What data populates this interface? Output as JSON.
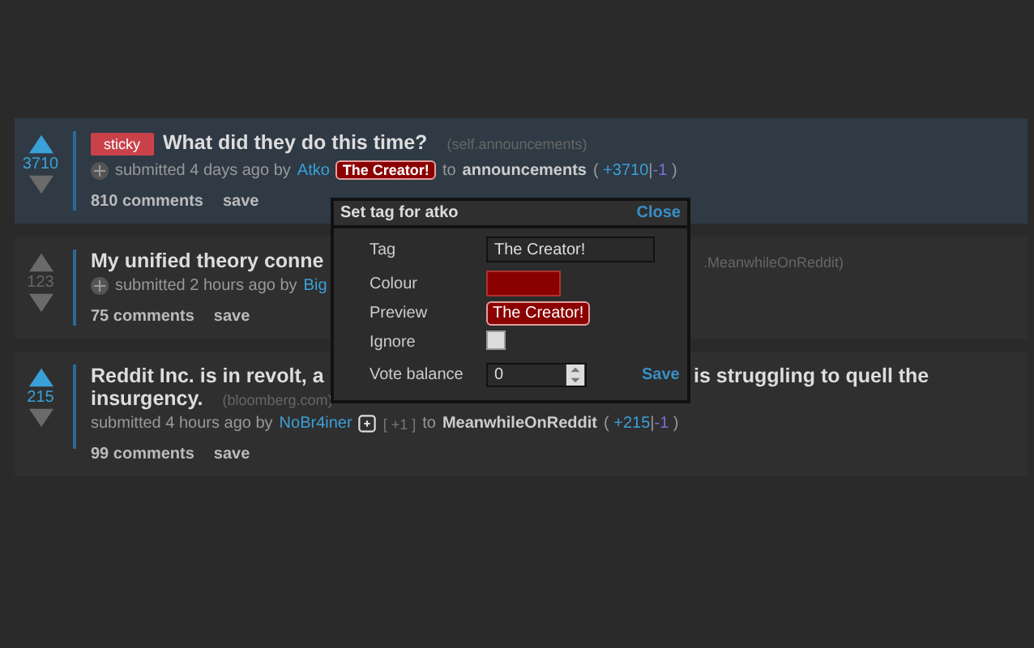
{
  "posts": [
    {
      "score": "3710",
      "upvoted": true,
      "highlighted": true,
      "lines": [
        {
          "left": [
            {
              "kind": "sticky",
              "text": "sticky"
            },
            {
              "kind": "title",
              "text": "What did they do this time?"
            },
            {
              "kind": "domain",
              "text": "(self.announcements)"
            }
          ]
        }
      ],
      "meta": {
        "expand_icon": true,
        "submitted": "submitted 4 days ago by",
        "author": "Atko",
        "tag": {
          "kind": "label",
          "text": "The Creator!"
        },
        "to": "to",
        "subreddit": "announcements",
        "open": "(",
        "up": "+3710",
        "sep": "|",
        "down": "-1",
        "close": ")"
      },
      "comments": "810 comments",
      "save": "save"
    },
    {
      "score": "123",
      "upvoted": false,
      "highlighted": false,
      "lines": [
        {
          "left": [
            {
              "kind": "title",
              "text": "My unified theory conne"
            }
          ],
          "right": [
            {
              "kind": "domain",
              "text": ".MeanwhileOnReddit)"
            }
          ]
        }
      ],
      "meta": {
        "expand_icon": true,
        "submitted": "submitted 2 hours ago by",
        "author": "Big"
      },
      "comments": "75 comments",
      "save": "save"
    },
    {
      "score": "215",
      "upvoted": true,
      "highlighted": false,
      "lines": [
        {
          "left": [
            {
              "kind": "title",
              "text": "Reddit Inc. is in revolt, a"
            }
          ],
          "right": [
            {
              "kind": "title",
              "text": "is struggling to quell the"
            }
          ]
        },
        {
          "left": [
            {
              "kind": "title",
              "text": "insurgency."
            },
            {
              "kind": "domain",
              "text": "(bloomberg.com)"
            }
          ]
        }
      ],
      "meta": {
        "expand_icon": false,
        "submitted": "submitted 4 hours ago by",
        "author": "NoBr4iner",
        "tag": {
          "kind": "add"
        },
        "tally": "[ +1 ]",
        "to": "to",
        "subreddit": "MeanwhileOnReddit",
        "open": "(",
        "up": "+215",
        "sep": "|",
        "down": "-1",
        "close": ")"
      },
      "comments": "99 comments",
      "save": "save"
    }
  ],
  "popup": {
    "title": "Set tag for atko",
    "close": "Close",
    "tag_label": "Tag",
    "tag_value": "The Creator!",
    "colour_label": "Colour",
    "color": "#8b0000",
    "preview_label": "Preview",
    "preview": "The Creator!",
    "ignore_label": "Ignore",
    "ignore": false,
    "vote_label": "Vote balance",
    "vote_value": "0",
    "save": "Save"
  }
}
